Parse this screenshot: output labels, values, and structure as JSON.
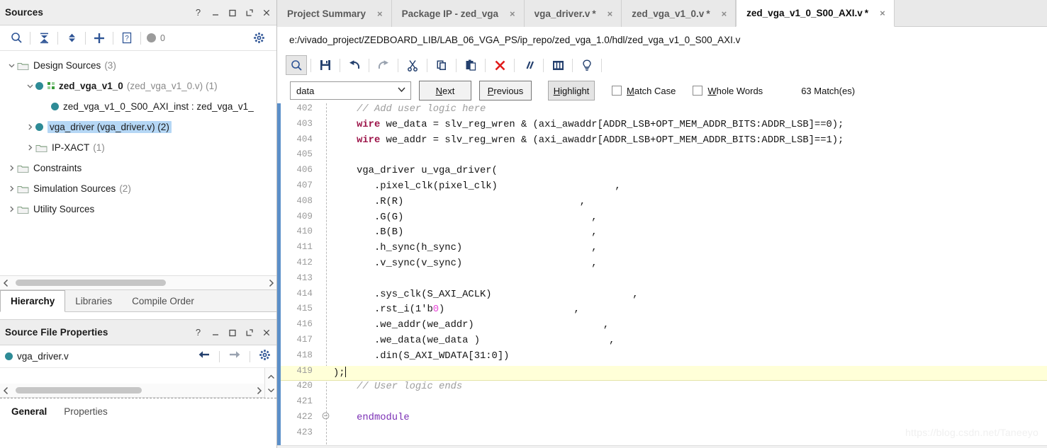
{
  "sources_panel": {
    "title": "Sources",
    "header_buttons": [
      "help-icon",
      "minimize-icon",
      "maximize-icon",
      "float-icon",
      "close-icon"
    ],
    "toolbar": {
      "search": "search-icon",
      "collapse_all": "collapse-all-icon",
      "expand_all": "expand-all-icon",
      "add": "plus-icon",
      "report": "report-icon",
      "badge_count": "0",
      "settings": "gear-icon"
    },
    "tree": [
      {
        "label": "Design Sources",
        "suffix": "(3)",
        "indent": 0,
        "twisty": "down",
        "icon": "folder",
        "bold": false,
        "highlight": false
      },
      {
        "label": "zed_vga_v1_0",
        "paren": "(zed_vga_v1_0.v)",
        "suffix": "(1)",
        "indent": 1,
        "twisty": "down",
        "icon": "dot-grid",
        "bold": true,
        "highlight": false
      },
      {
        "label": "zed_vga_v1_0_S00_AXI_inst : zed_vga_v1_",
        "indent": 2,
        "twisty": "none",
        "icon": "dot",
        "bold": false,
        "highlight": false
      },
      {
        "label": "vga_driver (vga_driver.v) (2)",
        "indent": 1,
        "twisty": "right",
        "icon": "dot",
        "bold": false,
        "highlight": true
      },
      {
        "label": "IP-XACT",
        "suffix": "(1)",
        "indent": 1,
        "twisty": "right",
        "icon": "folder",
        "bold": false,
        "highlight": false
      },
      {
        "label": "Constraints",
        "indent": 0,
        "twisty": "right",
        "icon": "folder",
        "bold": false,
        "highlight": false
      },
      {
        "label": "Simulation Sources",
        "suffix": "(2)",
        "indent": 0,
        "twisty": "right",
        "icon": "folder",
        "bold": false,
        "highlight": false
      },
      {
        "label": "Utility Sources",
        "indent": 0,
        "twisty": "right",
        "icon": "folder",
        "bold": false,
        "highlight": false
      }
    ],
    "bottom_tabs": [
      {
        "label": "Hierarchy",
        "selected": true
      },
      {
        "label": "Libraries",
        "selected": false
      },
      {
        "label": "Compile Order",
        "selected": false
      }
    ]
  },
  "properties_panel": {
    "title": "Source File Properties",
    "header_buttons": [
      "help-icon",
      "minimize-icon",
      "maximize-icon",
      "float-icon",
      "close-icon"
    ],
    "file_name": "vga_driver.v",
    "actions": [
      "back-arrow-icon",
      "forward-arrow-icon",
      "gear-icon"
    ],
    "tabs": [
      {
        "label": "General",
        "selected": true
      },
      {
        "label": "Properties",
        "selected": false
      }
    ]
  },
  "editor": {
    "tabs": [
      {
        "label": "Project Summary",
        "modified": false,
        "active": false
      },
      {
        "label": "Package IP - zed_vga",
        "modified": false,
        "active": false
      },
      {
        "label": "vga_driver.v",
        "modified": true,
        "active": false
      },
      {
        "label": "zed_vga_v1_0.v",
        "modified": true,
        "active": false
      },
      {
        "label": "zed_vga_v1_0_S00_AXI.v",
        "modified": true,
        "active": true
      }
    ],
    "close_glyph": "×",
    "modified_marker": "*",
    "path": "e:/vivado_project/ZEDBOARD_LIB/LAB_06_VGA_PS/ip_repo/zed_vga_1.0/hdl/zed_vga_v1_0_S00_AXI.v",
    "toolbar_icons": [
      "find-icon",
      "save-icon",
      "undo-icon",
      "redo-icon",
      "cut-icon",
      "copy-icon",
      "paste-icon",
      "delete-icon",
      "comment-icon",
      "columns-icon",
      "bulb-icon"
    ],
    "find": {
      "query": "data",
      "dropdown_glyph": "v",
      "next_label": "Next",
      "next_mnemonic": "N",
      "previous_label": "Previous",
      "previous_mnemonic": "P",
      "highlight_label": "Highlight",
      "highlight_mnemonic": "H",
      "match_case_label": "Match Case",
      "match_case_mnemonic": "M",
      "match_case_checked": false,
      "whole_words_label": "Whole Words",
      "whole_words_mnemonic": "W",
      "whole_words_checked": false,
      "match_count": "63 Match(es)"
    },
    "highlighted_line": 419,
    "lines": [
      {
        "n": 402,
        "segments": [
          {
            "t": "    ",
            "c": ""
          },
          {
            "t": "// Add user logic here",
            "c": "cmt"
          }
        ]
      },
      {
        "n": 403,
        "segments": [
          {
            "t": "    ",
            "c": ""
          },
          {
            "t": "wire",
            "c": "kw"
          },
          {
            "t": " we_data = slv_reg_wren & (axi_awaddr[ADDR_LSB+OPT_MEM_ADDR_BITS:ADDR_LSB]==0);",
            "c": ""
          }
        ]
      },
      {
        "n": 404,
        "segments": [
          {
            "t": "    ",
            "c": ""
          },
          {
            "t": "wire",
            "c": "kw"
          },
          {
            "t": " we_addr = slv_reg_wren & (axi_awaddr[ADDR_LSB+OPT_MEM_ADDR_BITS:ADDR_LSB]==1);",
            "c": ""
          }
        ]
      },
      {
        "n": 405,
        "segments": []
      },
      {
        "n": 406,
        "segments": [
          {
            "t": "    vga_driver u_vga_driver(",
            "c": ""
          }
        ]
      },
      {
        "n": 407,
        "segments": [
          {
            "t": "       .pixel_clk(pixel_clk)                    ,",
            "c": ""
          }
        ]
      },
      {
        "n": 408,
        "segments": [
          {
            "t": "       .R(R)                              ,",
            "c": ""
          }
        ]
      },
      {
        "n": 409,
        "segments": [
          {
            "t": "       .G(G)                                ,",
            "c": ""
          }
        ]
      },
      {
        "n": 410,
        "segments": [
          {
            "t": "       .B(B)                                ,",
            "c": ""
          }
        ]
      },
      {
        "n": 411,
        "segments": [
          {
            "t": "       .h_sync(h_sync)                      ,",
            "c": ""
          }
        ]
      },
      {
        "n": 412,
        "segments": [
          {
            "t": "       .v_sync(v_sync)                      ,",
            "c": ""
          }
        ]
      },
      {
        "n": 413,
        "segments": []
      },
      {
        "n": 414,
        "segments": [
          {
            "t": "       .sys_clk(S_AXI_ACLK)                        ,",
            "c": ""
          }
        ]
      },
      {
        "n": 415,
        "segments": [
          {
            "t": "       .rst_i(1'b",
            "c": ""
          },
          {
            "t": "0",
            "c": "num"
          },
          {
            "t": ")                      ,",
            "c": ""
          }
        ]
      },
      {
        "n": 416,
        "segments": [
          {
            "t": "       .we_addr(we_addr)                      ,",
            "c": ""
          }
        ]
      },
      {
        "n": 417,
        "segments": [
          {
            "t": "       .we_data(we_data )                      ,",
            "c": ""
          }
        ]
      },
      {
        "n": 418,
        "segments": [
          {
            "t": "       .din(S_AXI_WDATA[31:0])",
            "c": ""
          }
        ]
      },
      {
        "n": 419,
        "segments": [
          {
            "t": ");",
            "c": ""
          }
        ],
        "caret": true
      },
      {
        "n": 420,
        "segments": [
          {
            "t": "    ",
            "c": ""
          },
          {
            "t": "// User logic ends",
            "c": "cmt"
          }
        ]
      },
      {
        "n": 421,
        "segments": []
      },
      {
        "n": 422,
        "segments": [
          {
            "t": "    ",
            "c": ""
          },
          {
            "t": "endmodule",
            "c": "mod"
          }
        ],
        "fold": true
      },
      {
        "n": 423,
        "segments": []
      }
    ]
  },
  "watermark": "https://blog.csdn.net/Taneeyo",
  "colors": {
    "accent_blue": "#2f5596",
    "teal_dot": "#2e8b96",
    "selection_blue": "#b5d7f5",
    "keyword": "#9c1348",
    "comment": "#9d9d9d",
    "module_kw": "#7b2fb5",
    "number": "#e643d6",
    "highlight_row": "#ffffd8"
  }
}
